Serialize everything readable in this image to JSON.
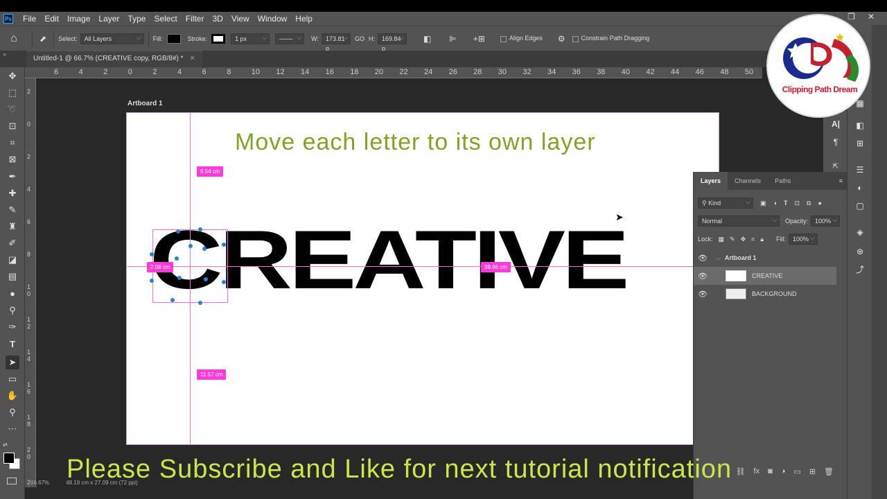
{
  "app": {
    "logo_text": "Ps",
    "menu": [
      "File",
      "Edit",
      "Image",
      "Layer",
      "Type",
      "Select",
      "Filter",
      "3D",
      "View",
      "Window",
      "Help"
    ]
  },
  "options_bar": {
    "select_label": "Select:",
    "select_value": "All Layers",
    "fill_label": "Fill:",
    "stroke_label": "Stroke:",
    "stroke_width": "1 px",
    "w_label": "W:",
    "w_value": "173.81 p",
    "go_label": "GO",
    "h_label": "H:",
    "h_value": "169.84 p",
    "align_edges": "Align Edges",
    "constrain": "Constrain Path Dragging"
  },
  "document": {
    "tab_title": "Untitled-1 @ 66.7% (CREATIVE copy, RGB/8#) *",
    "artboard_label": "Artboard 1",
    "zoom": "66.67%",
    "dimensions": "48.19 cm x 27.09 cm (72 ppi)"
  },
  "ruler_top": [
    "6",
    "4",
    "2",
    "0",
    "2",
    "4",
    "6",
    "8",
    "10",
    "12",
    "14",
    "16",
    "18",
    "20",
    "22",
    "24",
    "26",
    "28",
    "30",
    "32",
    "34",
    "36",
    "38",
    "40",
    "42",
    "44",
    "46",
    "48",
    "50"
  ],
  "ruler_left": [
    "2",
    "0",
    "2",
    "4",
    "6",
    "8",
    "1 0",
    "1 2",
    "1 4",
    "1 6",
    "1 8",
    "2 0",
    "2 2"
  ],
  "canvas": {
    "headline": "Move each letter to its own layer",
    "word": "CREATIVE",
    "measurements": {
      "top": "9.54 cm",
      "left": "2.08 cm",
      "right": "39.96 cm",
      "bottom": "11.57 cm"
    }
  },
  "layers_panel": {
    "tabs": [
      "Layers",
      "Channels",
      "Paths"
    ],
    "kind_label": "Kind",
    "blend_mode": "Normal",
    "opacity_label": "Opacity:",
    "opacity_value": "100%",
    "lock_label": "Lock:",
    "fill_label": "Fill:",
    "fill_value": "100%",
    "group": "Artboard 1",
    "layers": [
      "CREATIVE",
      "BACKGROUND"
    ]
  },
  "logo": {
    "text": "Clipping Path Dream"
  },
  "caption": "Please Subscribe and Like for next tutorial notification",
  "colors": {
    "headline": "#80a326",
    "caption": "#c9e64a",
    "measure_badge": "#ff3bd9",
    "guide": "#f26de0"
  }
}
